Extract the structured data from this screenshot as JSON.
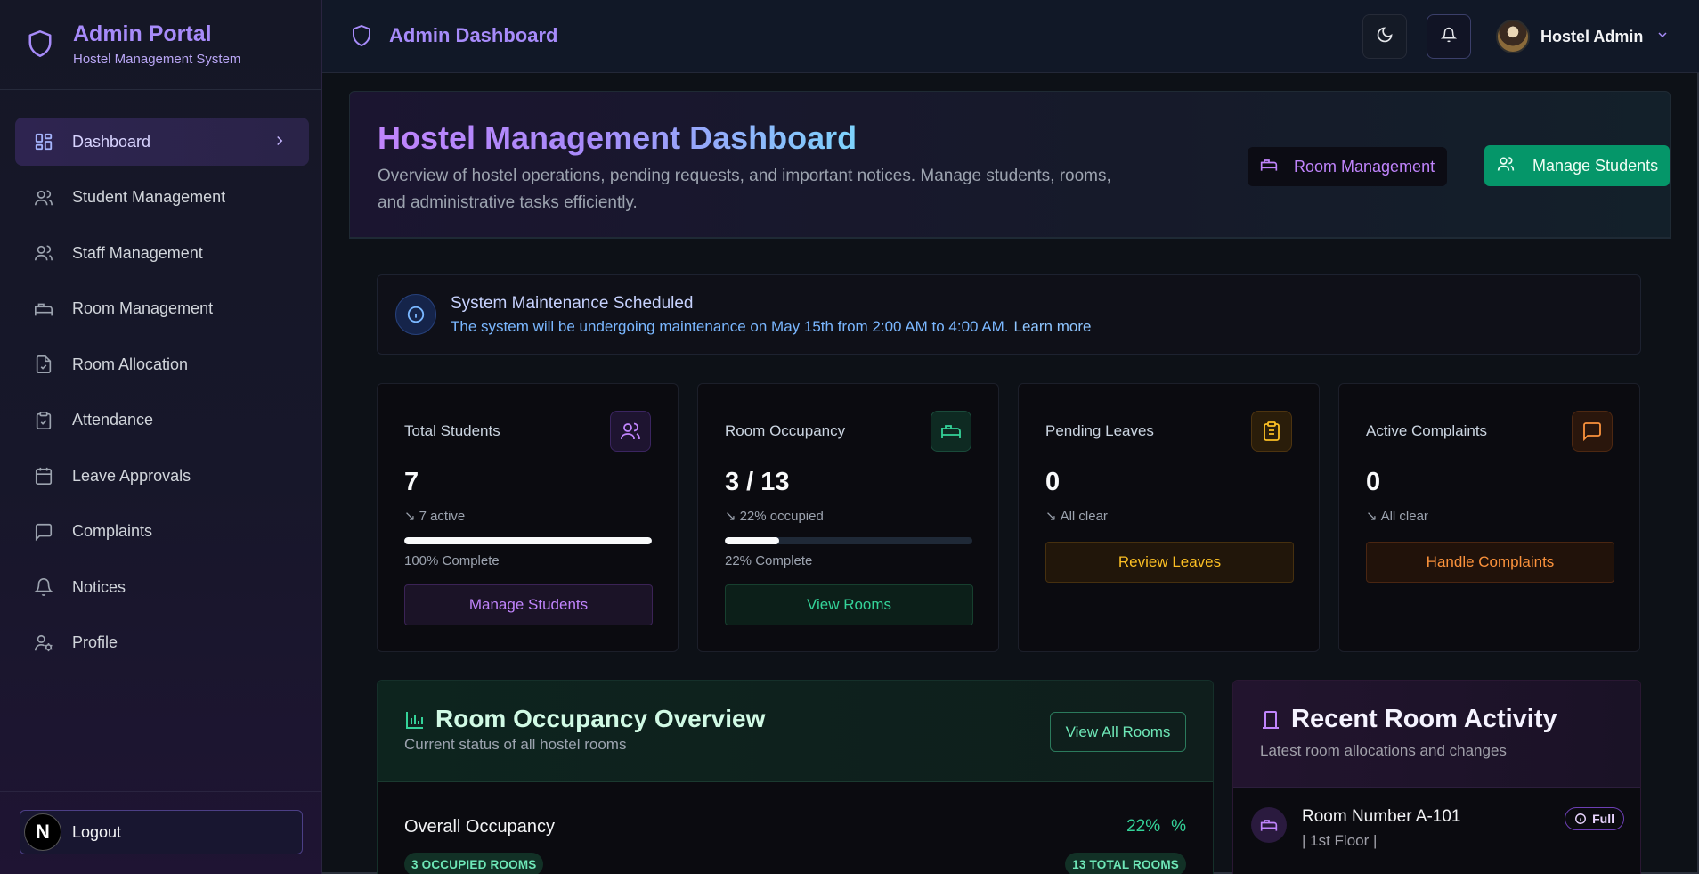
{
  "sidebar": {
    "brand_title": "Admin Portal",
    "brand_subtitle": "Hostel Management System",
    "items": [
      {
        "label": "Dashboard",
        "icon": "dashboard-grid-icon",
        "active": true
      },
      {
        "label": "Student Management",
        "icon": "users-icon"
      },
      {
        "label": "Staff Management",
        "icon": "users-icon"
      },
      {
        "label": "Room Management",
        "icon": "bed-icon"
      },
      {
        "label": "Room Allocation",
        "icon": "file-check-icon"
      },
      {
        "label": "Attendance",
        "icon": "clipboard-check-icon"
      },
      {
        "label": "Leave Approvals",
        "icon": "calendar-icon"
      },
      {
        "label": "Complaints",
        "icon": "message-square-icon"
      },
      {
        "label": "Notices",
        "icon": "bell-icon"
      },
      {
        "label": "Profile",
        "icon": "user-cog-icon"
      }
    ],
    "logout_label": "Logout",
    "logout_avatar_letter": "N"
  },
  "topbar": {
    "title": "Admin Dashboard",
    "user_name": "Hostel Admin"
  },
  "hero": {
    "title": "Hostel Management Dashboard",
    "description": "Overview of hostel operations, pending requests, and important notices. Manage students, rooms, and administrative tasks efficiently.",
    "room_button": "Room Management",
    "students_button": "Manage Students"
  },
  "alert": {
    "title": "System Maintenance Scheduled",
    "message": "The system will be undergoing maintenance on May 15th from 2:00 AM to 4:00 AM.",
    "link": "Learn more"
  },
  "cards": [
    {
      "title": "Total Students",
      "value": "7",
      "sub": "7 active",
      "progress": 100,
      "progress_label": "100% Complete",
      "button": "Manage Students",
      "accent": "#c084fc",
      "icon": "users-icon"
    },
    {
      "title": "Room Occupancy",
      "value": "3 / 13",
      "sub": "22% occupied",
      "progress": 22,
      "progress_label": "22% Complete",
      "button": "View Rooms",
      "accent": "#34d399",
      "icon": "bed-icon"
    },
    {
      "title": "Pending Leaves",
      "value": "0",
      "sub": "All clear",
      "button": "Review Leaves",
      "accent": "#fbbf24",
      "icon": "clipboard-icon"
    },
    {
      "title": "Active Complaints",
      "value": "0",
      "sub": "All clear",
      "button": "Handle Complaints",
      "accent": "#fb923c",
      "icon": "message-square-icon"
    }
  ],
  "occupancy": {
    "title": "Room Occupancy Overview",
    "subtitle": "Current status of all hostel rooms",
    "button": "View All Rooms",
    "overall_label": "Overall Occupancy",
    "overall_pct": "22%",
    "pct_symbol": "%",
    "occupied_pill": "3 OCCUPIED ROOMS",
    "total_pill": "13 TOTAL ROOMS"
  },
  "activity": {
    "title": "Recent Room Activity",
    "subtitle": "Latest room allocations and changes",
    "room": "Room Number A-101",
    "floor": "| 1st Floor |",
    "badge": "Full"
  },
  "colors": {
    "accent_purple": "#a78bfa",
    "accent_green": "#059669",
    "accent_amber": "#fbbf24",
    "accent_orange": "#fb923c"
  }
}
